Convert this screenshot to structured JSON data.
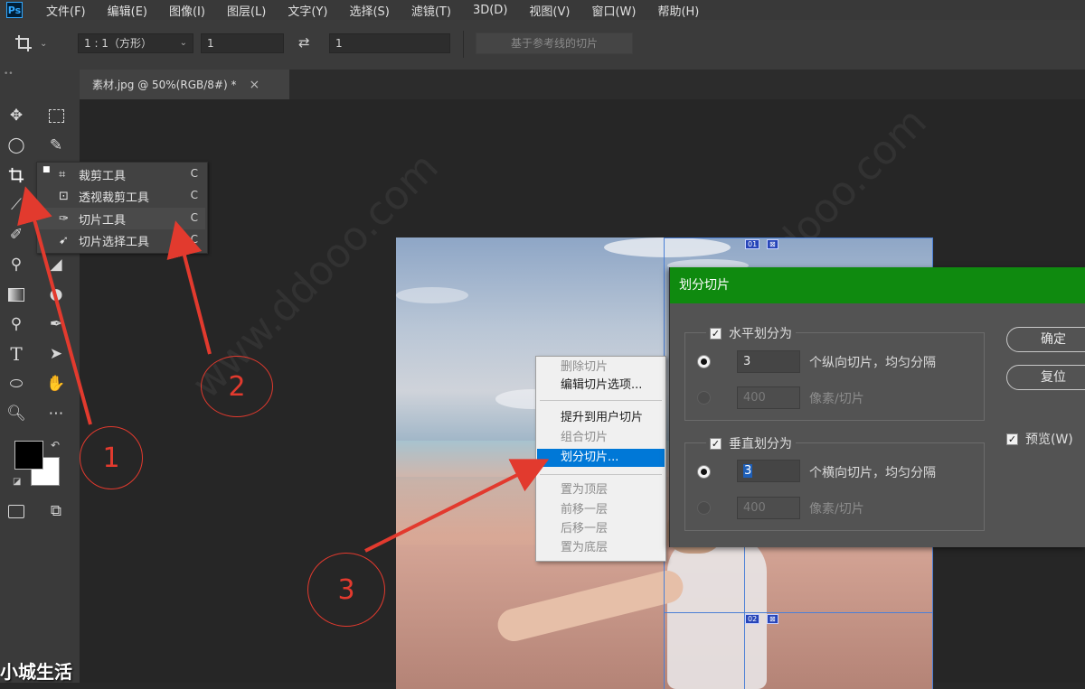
{
  "menubar": {
    "logo": "Ps",
    "items": [
      "文件(F)",
      "编辑(E)",
      "图像(I)",
      "图层(L)",
      "文字(Y)",
      "选择(S)",
      "滤镜(T)",
      "3D(D)",
      "视图(V)",
      "窗口(W)",
      "帮助(H)"
    ]
  },
  "options": {
    "tool_icon": "crop-icon",
    "ratio_select": "1 : 1（方形）",
    "width_value": "1",
    "swap_icon": "swap-icon",
    "height_value": "1",
    "slice_from_guides": "基于参考线的切片"
  },
  "document_tab": {
    "title": "素材.jpg @ 50%(RGB/8#) *",
    "close": "×"
  },
  "tool_flyout": {
    "items": [
      {
        "label": "裁剪工具",
        "key": "C",
        "icon": "crop-icon",
        "active": true
      },
      {
        "label": "透视裁剪工具",
        "key": "C",
        "icon": "perspective-crop-icon",
        "active": false
      },
      {
        "label": "切片工具",
        "key": "C",
        "icon": "slice-icon",
        "active": false
      },
      {
        "label": "切片选择工具",
        "key": "C",
        "icon": "slice-select-icon",
        "active": false
      }
    ]
  },
  "context_menu": {
    "items": [
      {
        "label": "删除切片",
        "state": "disabled"
      },
      {
        "label": "编辑切片选项...",
        "state": "normal"
      },
      {
        "label": "提升到用户切片",
        "state": "normal"
      },
      {
        "label": "组合切片",
        "state": "disabled"
      },
      {
        "label": "划分切片...",
        "state": "selected"
      },
      {
        "label": "置为顶层",
        "state": "disabled"
      },
      {
        "label": "前移一层",
        "state": "disabled"
      },
      {
        "label": "后移一层",
        "state": "disabled"
      },
      {
        "label": "置为底层",
        "state": "disabled"
      }
    ]
  },
  "slice_badges": {
    "top": "01",
    "bottom": "02"
  },
  "dialog": {
    "title": "划分切片",
    "horizontal": {
      "label": "水平划分为",
      "checked": true,
      "count_value": "3",
      "count_text": "个纵向切片，均匀分隔",
      "pixel_value": "400",
      "pixel_text": "像素/切片"
    },
    "vertical": {
      "label": "垂直划分为",
      "checked": true,
      "count_value": "3",
      "count_text": "个横向切片，均匀分隔",
      "pixel_value": "400",
      "pixel_text": "像素/切片"
    },
    "ok": "确定",
    "reset": "复位",
    "preview": "预览(W)"
  },
  "annotations": {
    "one": "1",
    "two": "2",
    "three": "3",
    "color": "#e23a2e"
  },
  "watermark": "小城生活",
  "colors": {
    "dialog_title_bg": "#0f8a0f",
    "menu_selected": "#0078d7"
  }
}
